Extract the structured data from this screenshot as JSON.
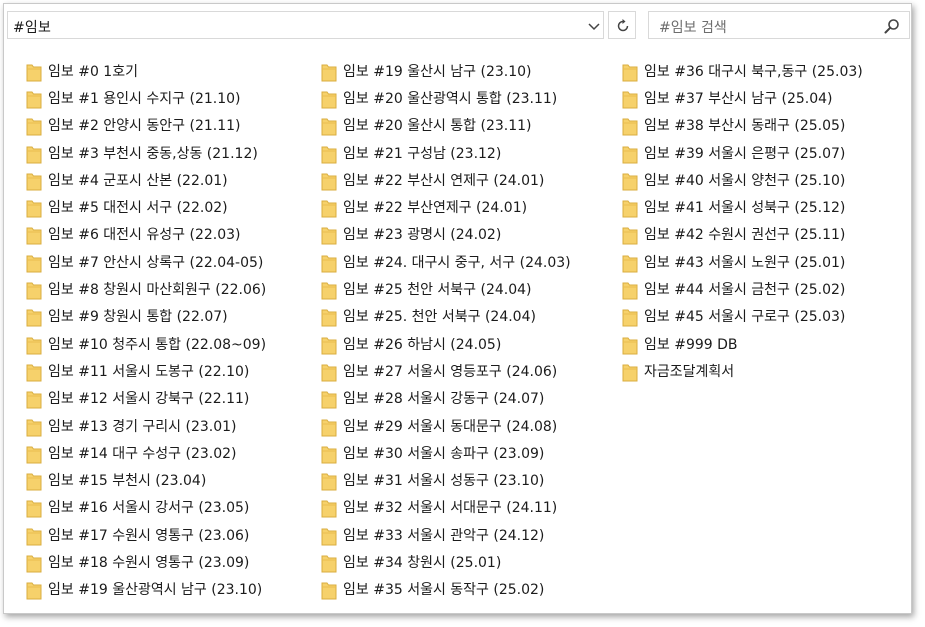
{
  "address_bar": {
    "path": "#임보"
  },
  "search": {
    "placeholder": "#임보 검색"
  },
  "icons": {
    "folder": "folder-icon",
    "search": "search-icon",
    "refresh": "refresh-icon",
    "dropdown": "chevron-down-icon",
    "folder_color": "#f6d16b"
  },
  "folders": {
    "column1": [
      "임보 #0 1호기",
      "임보 #1 용인시 수지구 (21.10)",
      "임보 #2 안양시 동안구 (21.11)",
      "임보 #3 부천시 중동,상동 (21.12)",
      "임보 #4 군포시 산본 (22.01)",
      "임보 #5 대전시 서구 (22.02)",
      "임보 #6 대전시 유성구 (22.03)",
      "임보 #7 안산시 상록구 (22.04-05)",
      "임보 #8 창원시 마산회원구 (22.06)",
      "임보 #9 창원시 통합 (22.07)",
      "임보 #10 청주시 통합 (22.08~09)",
      "임보 #11 서울시 도봉구 (22.10)",
      "임보 #12 서울시 강북구 (22.11)",
      "임보 #13 경기 구리시 (23.01)",
      "임보 #14 대구 수성구 (23.02)",
      "임보 #15 부천시 (23.04)",
      "임보 #16 서울시 강서구 (23.05)",
      "임보 #17 수원시 영통구 (23.06)",
      "임보 #18 수원시 영통구 (23.09)",
      "임보 #19 울산광역시 남구 (23.10)"
    ],
    "column2": [
      "임보 #19 울산시 남구 (23.10)",
      "임보 #20 울산광역시 통합 (23.11)",
      "임보 #20 울산시 통합 (23.11)",
      "임보 #21 구성남 (23.12)",
      "임보 #22 부산시 연제구 (24.01)",
      "임보 #22 부산연제구 (24.01)",
      "임보 #23 광명시 (24.02)",
      "임보 #24. 대구시 중구, 서구 (24.03)",
      "임보 #25 천안 서북구 (24.04)",
      "임보 #25. 천안 서북구 (24.04)",
      "임보 #26 하남시 (24.05)",
      "임보 #27 서울시 영등포구 (24.06)",
      "임보 #28 서울시 강동구 (24.07)",
      "임보 #29 서울시 동대문구 (24.08)",
      "임보 #30 서울시 송파구 (23.09)",
      "임보 #31 서울시 성동구 (23.10)",
      "임보 #32 서울시 서대문구 (24.11)",
      "임보 #33 서울시 관악구 (24.12)",
      "임보 #34 창원시 (25.01)",
      "임보 #35 서울시 동작구 (25.02)"
    ],
    "column3": [
      "임보 #36 대구시 북구,동구 (25.03)",
      "임보 #37 부산시 남구 (25.04)",
      "임보 #38 부산시 동래구 (25.05)",
      "임보 #39 서울시 은평구 (25.07)",
      "임보 #40 서울시 양천구 (25.10)",
      "임보 #41 서울시 성북구 (25.12)",
      "임보 #42 수원시 권선구 (25.11)",
      "임보 #43 서울시 노원구 (25.01)",
      "임보 #44 서울시 금천구 (25.02)",
      "임보 #45 서울시 구로구 (25.03)",
      "임보 #999 DB",
      "자금조달계획서"
    ]
  }
}
